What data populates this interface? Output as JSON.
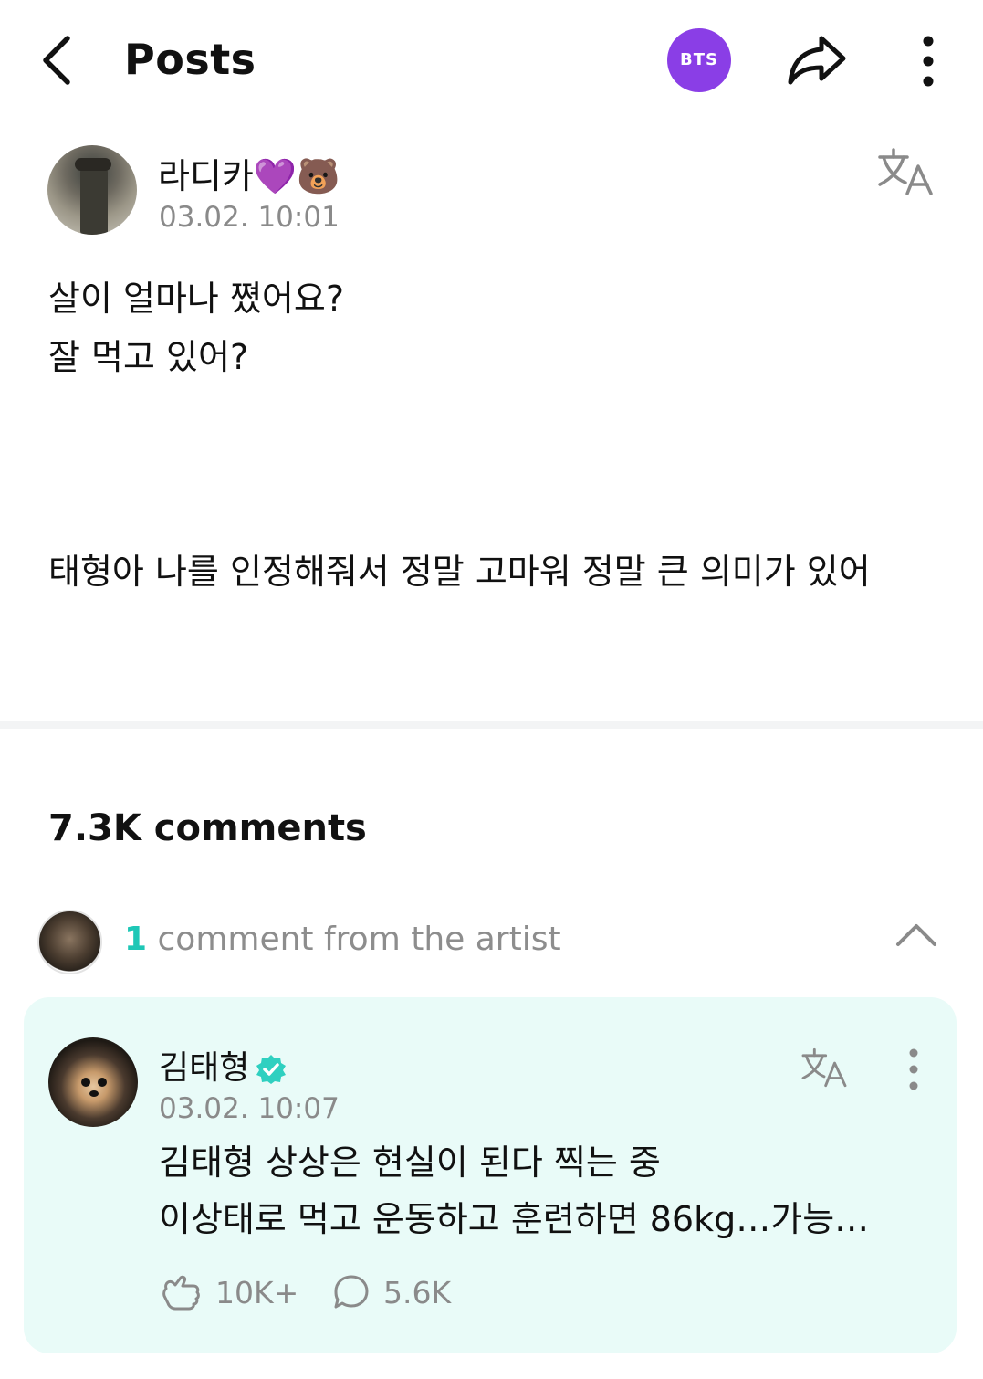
{
  "header": {
    "title": "Posts",
    "community_badge": "BTS",
    "back_icon": "chevron-left-icon",
    "share_icon": "share-icon",
    "more_icon": "vertical-dots-icon"
  },
  "post": {
    "author": "라디카💜🐻",
    "time": "03.02. 10:01",
    "translate_icon": "translate-icon",
    "body_lines": [
      "살이 얼마나 쪘어요?",
      "잘 먹고 있어?"
    ],
    "body_line_2": "태형아 나를 인정해줘서 정말 고마워 정말 큰 의미가 있어"
  },
  "comments": {
    "count_label": "7.3K comments",
    "artist_section": {
      "count": "1",
      "label": " comment from the artist",
      "collapse_icon": "chevron-up-icon"
    },
    "artist_comment": {
      "author": "김태형",
      "verified_icon": "verified-badge-icon",
      "time": "03.02. 10:07",
      "lines": [
        "김태형 상상은 현실이 된다 찍는 중",
        "이상태로 먹고 운동하고 훈련하면 86kg…가능…"
      ],
      "likes": "10K+",
      "replies": "5.6K"
    }
  },
  "colors": {
    "accent_purple": "#8a3ee6",
    "teal": "#1ec7b6",
    "card_bg": "#e9fbf8",
    "muted_text": "#8a8a8a"
  }
}
